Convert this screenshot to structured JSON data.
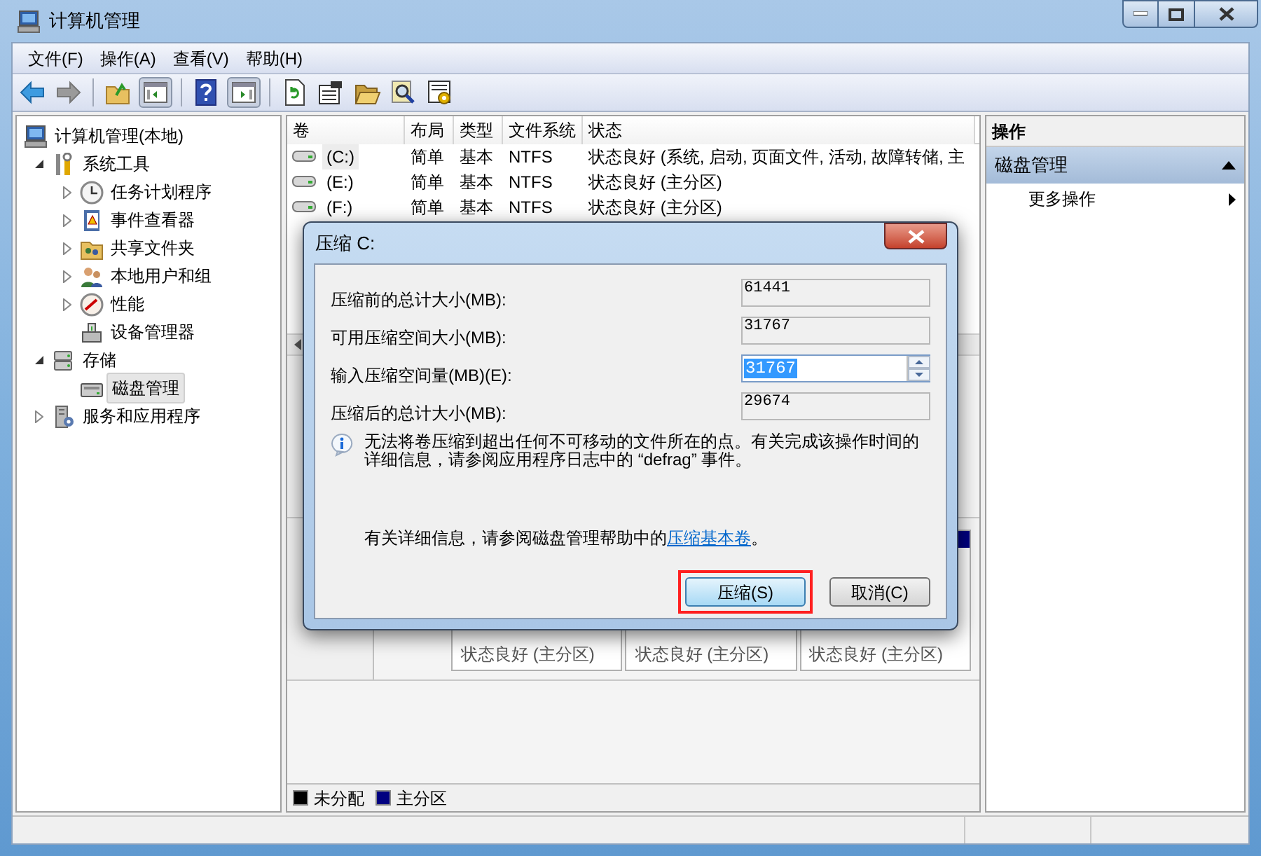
{
  "window": {
    "title": "计算机管理"
  },
  "menu": [
    "文件(F)",
    "操作(A)",
    "查看(V)",
    "帮助(H)"
  ],
  "toolbar": [
    {
      "kind": "back",
      "pressed": false
    },
    {
      "kind": "forward",
      "pressed": false
    },
    {
      "kind": "sep"
    },
    {
      "kind": "up",
      "pressed": false
    },
    {
      "kind": "tree-pane",
      "pressed": true
    },
    {
      "kind": "sep"
    },
    {
      "kind": "help",
      "pressed": false
    },
    {
      "kind": "action-pane",
      "pressed": true
    },
    {
      "kind": "sep"
    },
    {
      "kind": "refresh",
      "pressed": false
    },
    {
      "kind": "properties",
      "pressed": false
    },
    {
      "kind": "open",
      "pressed": false
    },
    {
      "kind": "find",
      "pressed": false
    },
    {
      "kind": "settings",
      "pressed": false
    }
  ],
  "tree": [
    {
      "label": "计算机管理(本地)",
      "selected": false,
      "children": [
        {
          "label": "系统工具",
          "expanded": true,
          "selected": false,
          "children": [
            {
              "label": "任务计划程序",
              "expanded": false,
              "selected": false
            },
            {
              "label": "事件查看器",
              "expanded": false,
              "selected": false
            },
            {
              "label": "共享文件夹",
              "expanded": false,
              "selected": false
            },
            {
              "label": "本地用户和组",
              "expanded": false,
              "selected": false
            },
            {
              "label": "性能",
              "expanded": false,
              "selected": false
            },
            {
              "label": "设备管理器",
              "selected": false
            }
          ]
        },
        {
          "label": "存储",
          "expanded": true,
          "selected": false,
          "children": [
            {
              "label": "磁盘管理",
              "selected": true
            }
          ]
        },
        {
          "label": "服务和应用程序",
          "expanded": false,
          "selected": false
        }
      ]
    }
  ],
  "volumes": {
    "columns": [
      "卷",
      "布局",
      "类型",
      "文件系统",
      "状态"
    ],
    "rows": [
      {
        "cells": [
          "(C:)",
          "简单",
          "基本",
          "NTFS",
          "状态良好 (系统, 启动, 页面文件, 活动, 故障转储, 主"
        ],
        "selected": true
      },
      {
        "cells": [
          "(E:)",
          "简单",
          "基本",
          "NTFS",
          "状态良好 (主分区)"
        ],
        "selected": false
      },
      {
        "cells": [
          "(F:)",
          "简单",
          "基本",
          "NTFS",
          "状态良好 (主分区)"
        ],
        "selected": false
      }
    ]
  },
  "disk_view": {
    "partitions": [
      {
        "status": "状态良好 (主分区)"
      },
      {
        "status": "状态良好 (主分区)"
      },
      {
        "status": "状态良好 (主分区)"
      }
    ],
    "legend": [
      {
        "label": "未分配",
        "color": "#000000"
      },
      {
        "label": "主分区",
        "color": "#000080"
      }
    ]
  },
  "actions": {
    "title": "操作",
    "section": {
      "label": "磁盘管理",
      "expanded": true
    },
    "items": [
      {
        "label": "更多操作"
      }
    ]
  },
  "dialog": {
    "title": "压缩 C:",
    "fields": [
      {
        "label": "压缩前的总计大小(MB):",
        "value": "61441",
        "kind": "readonly"
      },
      {
        "label": "可用压缩空间大小(MB):",
        "value": "31767",
        "kind": "readonly"
      },
      {
        "label": "输入压缩空间量(MB)(E):",
        "value": "31767",
        "kind": "spin"
      },
      {
        "label": "压缩后的总计大小(MB):",
        "value": "29674",
        "kind": "readonly"
      }
    ],
    "note": "无法将卷压缩到超出任何不可移动的文件所在的点。有关完成该操作时间的详细信息，请参阅应用程序日志中的 “defrag” 事件。",
    "help_text": "有关详细信息，请参阅磁盘管理帮助中的",
    "help_link": "压缩基本卷",
    "help_end": "。",
    "buttons": [
      {
        "label": "压缩(S)",
        "default": true,
        "highlighted": true
      },
      {
        "label": "取消(C)",
        "default": false,
        "highlighted": false
      }
    ]
  }
}
